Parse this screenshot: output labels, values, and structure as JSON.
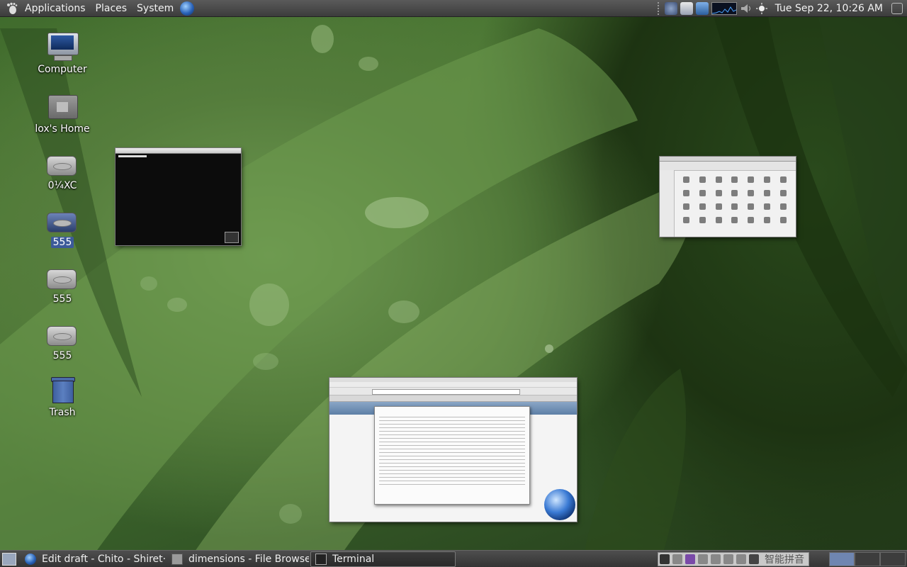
{
  "top_panel": {
    "menus": [
      "Applications",
      "Places",
      "System"
    ],
    "clock": "Tue Sep 22, 10:26 AM"
  },
  "desktop": {
    "icons": [
      {
        "label": "Computer",
        "icon": "computer-icon"
      },
      {
        "label": "lox's Home",
        "icon": "home-folder-icon"
      },
      {
        "label": "0¼XC",
        "icon": "drive-icon"
      },
      {
        "label": "555",
        "icon": "drive-icon",
        "selected": true
      },
      {
        "label": "555",
        "icon": "drive-icon"
      },
      {
        "label": "555",
        "icon": "drive-icon"
      },
      {
        "label": "Trash",
        "icon": "trash-icon"
      }
    ]
  },
  "taskbar": {
    "tasks": [
      {
        "label": "Edit draft - Chito - Shiret···",
        "icon": "browser-globe-icon",
        "active": false
      },
      {
        "label": "dimensions - File Browser",
        "icon": "file-browser-icon",
        "active": false
      },
      {
        "label": "Terminal",
        "icon": "terminal-icon",
        "active": true
      }
    ],
    "ime_label": "智能拼音"
  }
}
